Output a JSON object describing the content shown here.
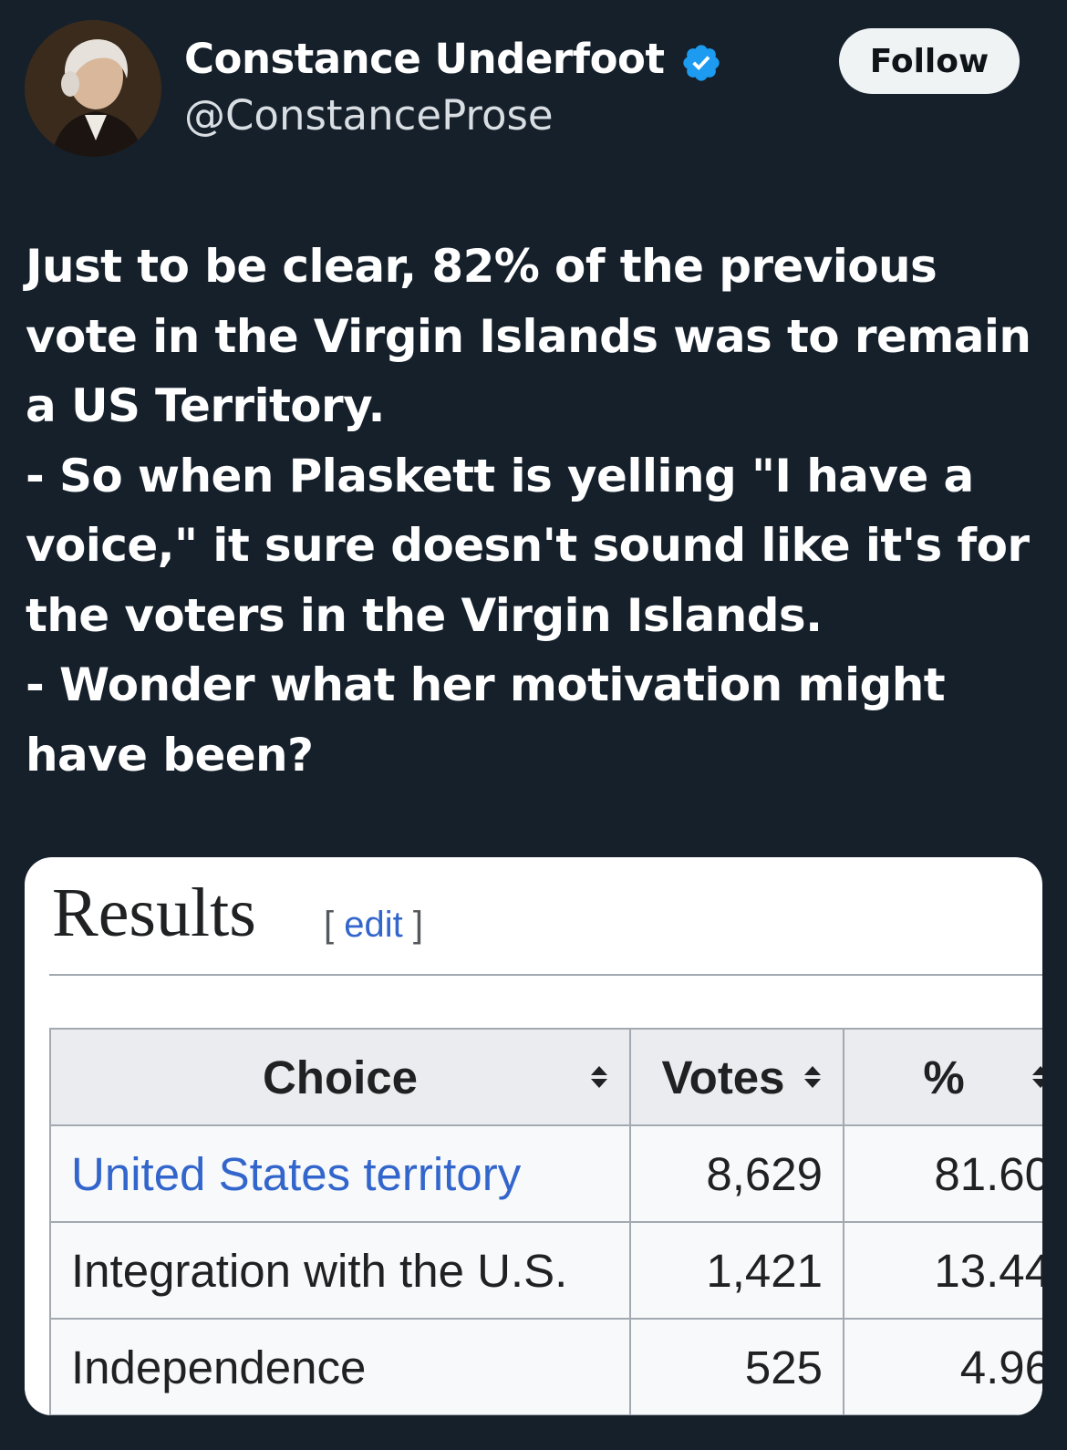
{
  "author": {
    "name": "Constance Underfoot",
    "handle": "@ConstanceProse",
    "avatar_icon": "portrait-avatar",
    "verified_icon": "verified-badge-icon",
    "verified_color": "#1d9bf0"
  },
  "follow_label": "Follow",
  "tweet": {
    "lines": [
      "Just to be clear, 82% of the previous",
      "vote in the Virgin Islands was to remain",
      "a US Territory.",
      "- So when Plaskett is yelling \"I have a",
      "voice,\" it sure doesn't sound like it's for",
      "the voters in the Virgin Islands.",
      "- Wonder what her motivation might",
      "have been?"
    ]
  },
  "card": {
    "title": "Results",
    "edit_open": "[ ",
    "edit_label": "edit",
    "edit_close": " ]",
    "table": {
      "headers": [
        "Choice",
        "Votes",
        "%"
      ],
      "sort_icon": "sort-arrows-icon",
      "rows": [
        {
          "choice": "United States territory",
          "votes": "8,629",
          "pct": "81.60",
          "is_link": true
        },
        {
          "choice": "Integration with the U.S.",
          "votes": "1,421",
          "pct": "13.44",
          "is_link": false
        },
        {
          "choice": "Independence",
          "votes": "525",
          "pct": "4.96",
          "is_link": false
        }
      ]
    },
    "link_color": "#3366cc"
  }
}
